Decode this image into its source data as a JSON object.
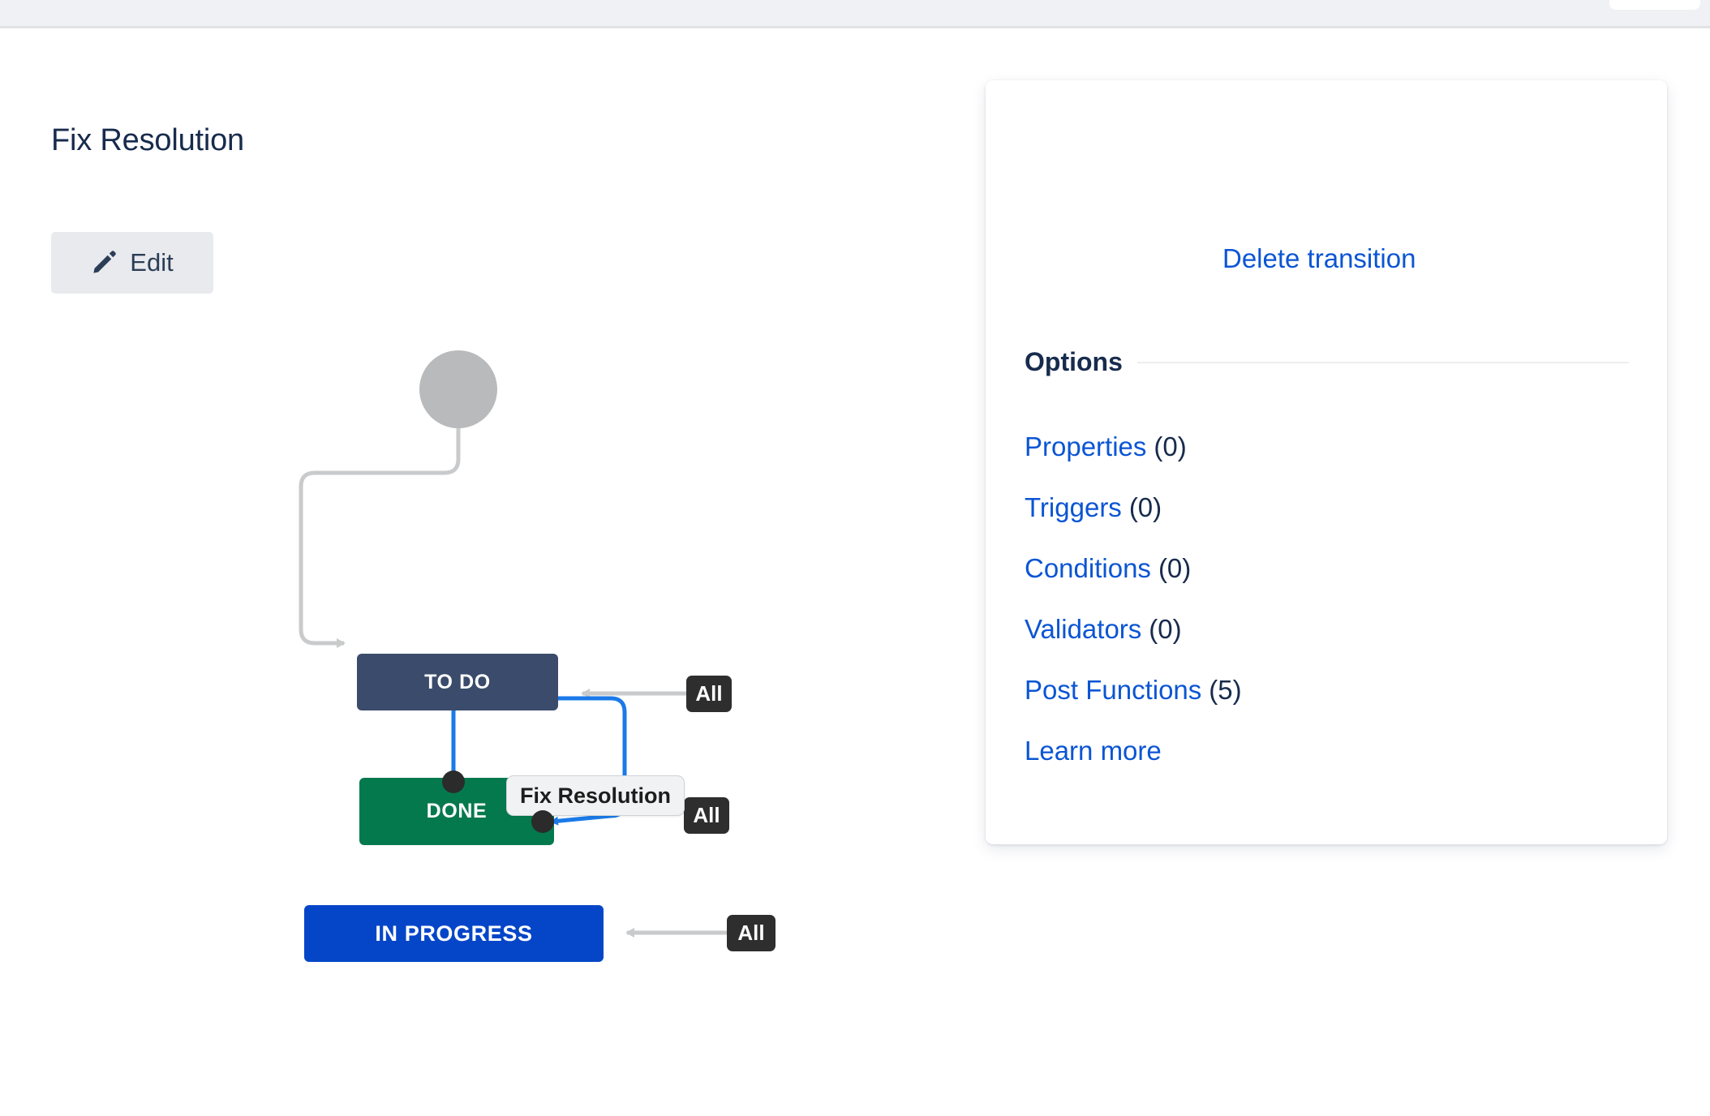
{
  "window": {
    "background_color": "#ffffff",
    "top_strip_color": "#f0f1f4"
  },
  "workflow": {
    "nodes": [
      {
        "id": "todo",
        "label": "TO DO",
        "color": "#3b4b6b"
      },
      {
        "id": "done",
        "label": "DONE",
        "color": "#05794e"
      },
      {
        "id": "in_progress",
        "label": "IN PROGRESS",
        "color": "#0546c8"
      }
    ],
    "start_node": {
      "name": "start-circle",
      "color": "#b9babc"
    },
    "condition_badges": [
      {
        "id": "all_todo",
        "label": "All"
      },
      {
        "id": "all_fix",
        "label": "All"
      },
      {
        "id": "all_inprogress",
        "label": "All"
      }
    ],
    "selected_transition": {
      "label": "Fix Resolution",
      "color": "#1a7ae8",
      "from": "DONE",
      "to": "TO DO"
    },
    "edge_color": "#c9cacb"
  },
  "panel": {
    "title": "Fix Resolution",
    "edit_label": "Edit",
    "edit_icon": "pencil-icon",
    "delete_label": "Delete transition",
    "options_heading": "Options",
    "options": [
      {
        "label": "Properties",
        "count": "(0)"
      },
      {
        "label": "Triggers",
        "count": "(0)"
      },
      {
        "label": "Conditions",
        "count": "(0)"
      },
      {
        "label": "Validators",
        "count": "(0)"
      },
      {
        "label": "Post Functions",
        "count": "(5)"
      },
      {
        "label": "Learn more",
        "count": ""
      }
    ],
    "link_color": "#0b55d4",
    "text_color": "#172b4d"
  }
}
